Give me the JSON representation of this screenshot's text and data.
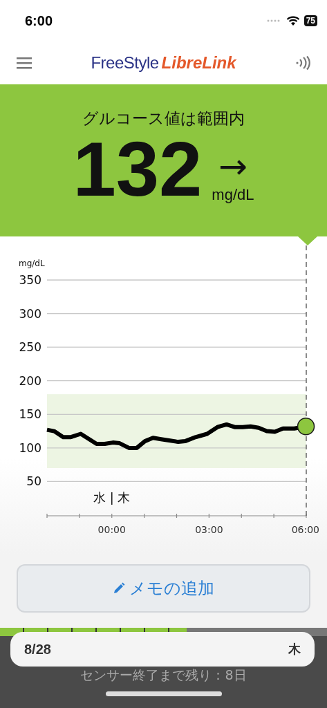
{
  "status_bar": {
    "time": "6:00",
    "battery": "75"
  },
  "header": {
    "logo_first": "FreeStyle",
    "logo_second": "LibreLink"
  },
  "reading": {
    "status": "グルコース値は範囲内",
    "value": "132",
    "unit": "mg/dL",
    "trend": "→"
  },
  "chart": {
    "chart_data": {
      "type": "line",
      "ylabel": "mg/dL",
      "xlim": [
        -2,
        6
      ],
      "ylim": [
        0,
        350
      ],
      "grid": true,
      "yticks": [
        50,
        100,
        150,
        200,
        250,
        300,
        350
      ],
      "xticks": [
        {
          "value": 0,
          "label": "00:00"
        },
        {
          "value": 3,
          "label": "03:00"
        },
        {
          "value": 6,
          "label": "06:00"
        }
      ],
      "x": [
        -2,
        -1.78,
        -1.5,
        -1.28,
        -0.96,
        -0.47,
        -0.22,
        0.03,
        0.24,
        0.53,
        0.77,
        1.02,
        1.27,
        1.52,
        2.05,
        2.26,
        2.58,
        2.94,
        3.26,
        3.54,
        3.79,
        4.04,
        4.28,
        4.53,
        4.78,
        5.03,
        5.28,
        5.63,
        5.99
      ],
      "series": [
        {
          "color": "#000000",
          "values": [
            127,
            125,
            116,
            116,
            121,
            106,
            106,
            108,
            107,
            100,
            100,
            110,
            115,
            113,
            109,
            110,
            116,
            121,
            131,
            135,
            131,
            131,
            132,
            130,
            125,
            124,
            129,
            129,
            132
          ]
        }
      ],
      "bands": [
        {
          "axis": "y",
          "from": 70,
          "to": 180,
          "color": "#edf5e3"
        }
      ],
      "annotations": [
        "水 | 木"
      ]
    }
  },
  "memo_button": {
    "label": "メモの追加"
  },
  "sensor": {
    "level": 0.57,
    "date": "8/28",
    "weekday": "木",
    "remaining": "センサー終了まで残り：8日"
  }
}
